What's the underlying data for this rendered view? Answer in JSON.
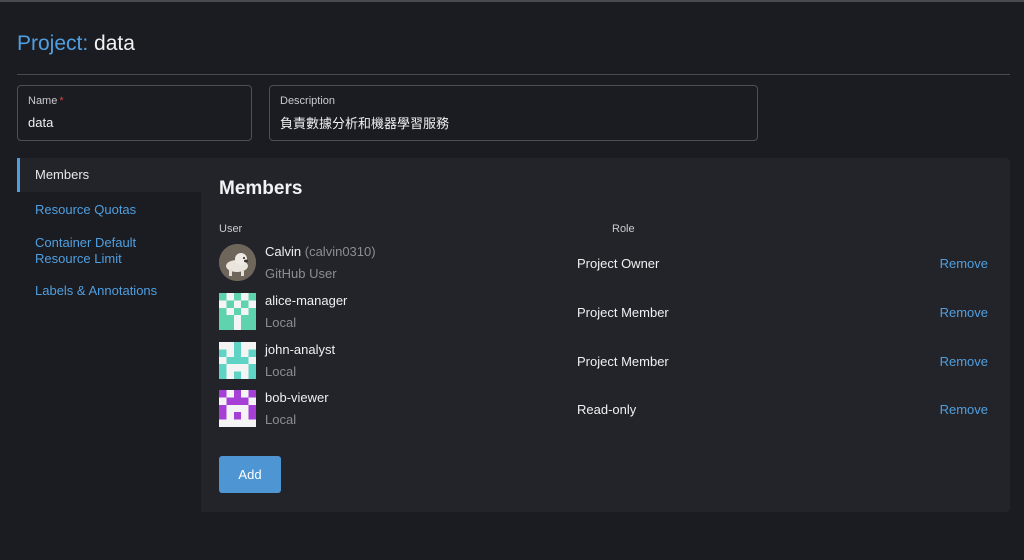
{
  "page": {
    "title_label": "Project:",
    "title_value": "data"
  },
  "fields": {
    "name_label": "Name",
    "name_required_mark": "*",
    "name_value": "data",
    "description_label": "Description",
    "description_value": "負責數據分析和機器學習服務"
  },
  "sidebar": {
    "items": [
      {
        "label": "Members"
      },
      {
        "label": "Resource Quotas"
      },
      {
        "label": "Container Default Resource Limit"
      },
      {
        "label": "Labels & Annotations"
      }
    ]
  },
  "members": {
    "title": "Members",
    "col_user": "User",
    "col_role": "Role",
    "rows": [
      {
        "name": "Calvin",
        "id": "(calvin0310)",
        "source": "GitHub User",
        "role": "Project Owner",
        "remove": "Remove",
        "avatar": "photo-avatar"
      },
      {
        "name": "alice-manager",
        "id": "",
        "source": "Local",
        "role": "Project Member",
        "remove": "Remove",
        "avatar": "identicon-avatar"
      },
      {
        "name": "john-analyst",
        "id": "",
        "source": "Local",
        "role": "Project Member",
        "remove": "Remove",
        "avatar": "identicon-avatar"
      },
      {
        "name": "bob-viewer",
        "id": "",
        "source": "Local",
        "role": "Read-only",
        "remove": "Remove",
        "avatar": "identicon-avatar"
      }
    ],
    "add_label": "Add"
  },
  "colors": {
    "accent": "#4f9fe0",
    "identicon_alice": "#5fd3ad",
    "identicon_john": "#5fd3c4",
    "identicon_bob": "#a63fd6"
  }
}
